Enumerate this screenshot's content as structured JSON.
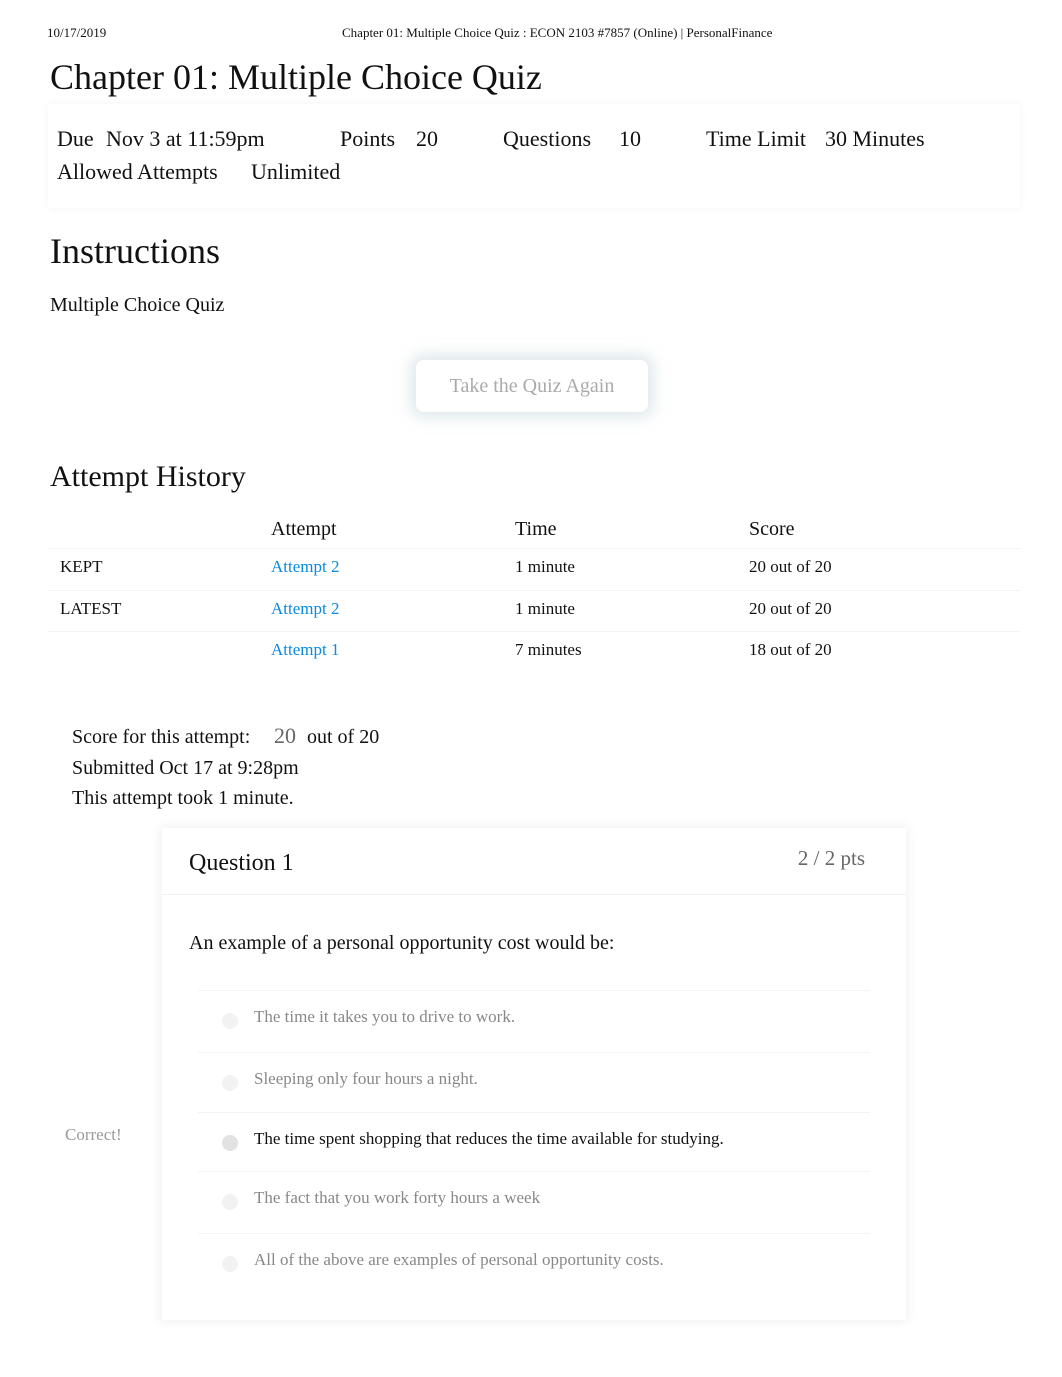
{
  "print_header": {
    "date": "10/17/2019",
    "title": "Chapter 01: Multiple Choice Quiz : ECON 2103 #7857 (Online) | PersonalFinance"
  },
  "quiz": {
    "title": "Chapter 01: Multiple Choice Quiz",
    "due_label": "Due",
    "due": "Nov 3 at 11:59pm",
    "points_label": "Points",
    "points": "20",
    "questions_label": "Questions",
    "questions": "10",
    "time_limit_label": "Time Limit",
    "time_limit": "30 Minutes",
    "attempts_label": "Allowed Attempts",
    "attempts": "Unlimited"
  },
  "instructions": {
    "heading": "Instructions",
    "text": "Multiple Choice Quiz"
  },
  "take_again_label": "Take the Quiz Again",
  "history": {
    "heading": "Attempt History",
    "columns": [
      "Attempt",
      "Time",
      "Score"
    ],
    "rows": [
      {
        "tag": "KEPT",
        "attempt": "Attempt 2",
        "time": "1 minute",
        "score": "20 out of 20"
      },
      {
        "tag": "LATEST",
        "attempt": "Attempt 2",
        "time": "1 minute",
        "score": "20 out of 20"
      },
      {
        "tag": "",
        "attempt": "Attempt 1",
        "time": "7 minutes",
        "score": "18 out of 20"
      }
    ]
  },
  "summary": {
    "score_label": "Score for this attempt:",
    "score": "20",
    "score_suffix": "out of 20",
    "submitted": "Submitted Oct 17 at 9:28pm",
    "duration": "This attempt took 1 minute."
  },
  "question": {
    "title": "Question 1",
    "pts": "2 / 2 pts",
    "text": "An example of a personal opportunity cost would be:",
    "correct_label": "Correct!",
    "answers": [
      "The time it takes you to drive to work.",
      "Sleeping only four hours a night.",
      "The time spent shopping that reduces the time available for studying.",
      "The fact that you work forty hours a week",
      "All of the above are examples of personal opportunity costs."
    ],
    "selected_index": 2
  },
  "colors": {
    "link": "#0a8ae0"
  }
}
